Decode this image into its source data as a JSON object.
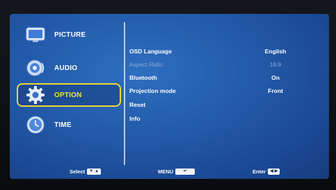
{
  "menu": {
    "items": [
      {
        "label": "PICTURE",
        "icon": "picture-icon",
        "selected": false
      },
      {
        "label": "AUDIO",
        "icon": "speaker-icon",
        "selected": false
      },
      {
        "label": "OPTION",
        "icon": "gear-icon",
        "selected": true
      },
      {
        "label": "TIME",
        "icon": "clock-icon",
        "selected": false
      }
    ]
  },
  "options": [
    {
      "label": "OSD Language",
      "value": "English",
      "enabled": true
    },
    {
      "label": "Aspect Ratio",
      "value": "16:9",
      "enabled": false
    },
    {
      "label": "Bluetooth",
      "value": "On",
      "enabled": true
    },
    {
      "label": "Projection mode",
      "value": "Front",
      "enabled": true
    },
    {
      "label": "Reset",
      "value": "",
      "enabled": true
    },
    {
      "label": "Info",
      "value": "",
      "enabled": true
    }
  ],
  "footer": {
    "select_label": "Select",
    "menu_label": "MENU",
    "enter_label": "Enter",
    "select_keys": [
      "▼",
      "▲"
    ],
    "menu_key": "↵",
    "enter_keys": [
      "◀",
      "▶"
    ]
  },
  "colors": {
    "background": "#2259a8",
    "highlight": "#f2d836",
    "text": "#ffffff"
  }
}
